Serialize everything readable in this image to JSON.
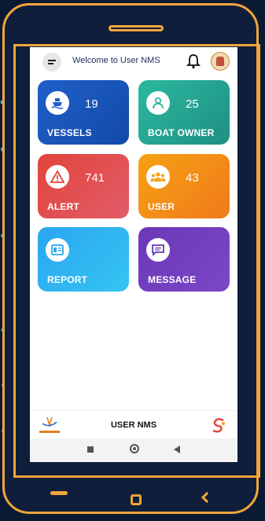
{
  "appbar": {
    "title": "Welcome to User NMS",
    "menu_icon": "menu-icon",
    "bell_icon": "notification-bell-icon",
    "emblem_icon": "state-emblem-icon"
  },
  "tiles": [
    {
      "label": "VESSELS",
      "count": "19",
      "icon": "ship-icon",
      "color": "#1f5fc9"
    },
    {
      "label": "BOAT OWNER",
      "count": "25",
      "icon": "person-icon",
      "color": "#2bb99f"
    },
    {
      "label": "ALERT",
      "count": "741",
      "icon": "warning-icon",
      "color": "#e2443b"
    },
    {
      "label": "USER",
      "count": "43",
      "icon": "group-icon",
      "color": "#f6a113"
    },
    {
      "label": "REPORT",
      "icon": "report-icon",
      "color": "#2aa6f0"
    },
    {
      "label": "MESSAGE",
      "icon": "message-icon",
      "color": "#6a38b8"
    }
  ],
  "footer": {
    "title": "USER NMS",
    "logo_left": "isro-logo-icon",
    "logo_right": "s-logo-icon"
  },
  "colors": {
    "frame": "#f2a53a",
    "background": "#0b1a33"
  }
}
